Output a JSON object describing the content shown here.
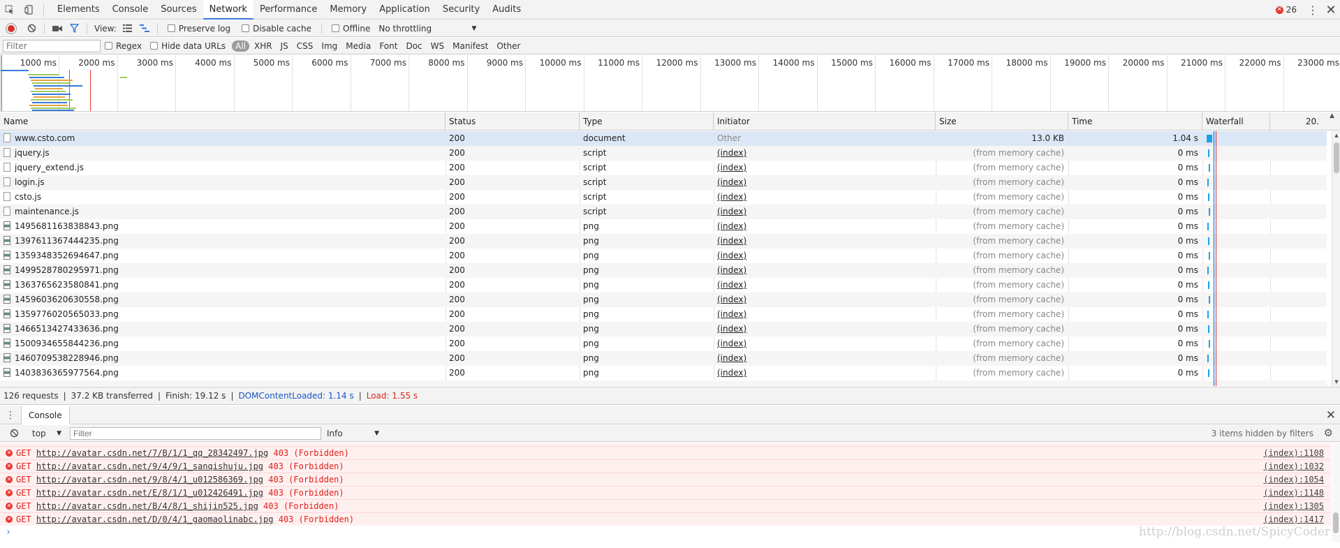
{
  "tabs": [
    "Elements",
    "Console",
    "Sources",
    "Network",
    "Performance",
    "Memory",
    "Application",
    "Security",
    "Audits"
  ],
  "active_tab": "Network",
  "error_count": "26",
  "toolbar": {
    "view_label": "View:",
    "preserve_log": "Preserve log",
    "disable_cache": "Disable cache",
    "offline": "Offline",
    "throttling": "No throttling"
  },
  "filterbar": {
    "placeholder": "Filter",
    "regex": "Regex",
    "hide_data_urls": "Hide data URLs",
    "types": [
      "All",
      "XHR",
      "JS",
      "CSS",
      "Img",
      "Media",
      "Font",
      "Doc",
      "WS",
      "Manifest",
      "Other"
    ]
  },
  "overview_ticks": [
    "1000 ms",
    "2000 ms",
    "3000 ms",
    "4000 ms",
    "5000 ms",
    "6000 ms",
    "7000 ms",
    "8000 ms",
    "9000 ms",
    "10000 ms",
    "11000 ms",
    "12000 ms",
    "13000 ms",
    "14000 ms",
    "15000 ms",
    "16000 ms",
    "17000 ms",
    "18000 ms",
    "19000 ms",
    "20000 ms",
    "21000 ms",
    "22000 ms",
    "23000 ms"
  ],
  "columns": {
    "name": "Name",
    "status": "Status",
    "type": "Type",
    "initiator": "Initiator",
    "size": "Size",
    "time": "Time",
    "waterfall": "Waterfall",
    "waterfall_scale": "20."
  },
  "rows": [
    {
      "name": "www.csto.com",
      "status": "200",
      "type": "document",
      "initiator": "Other",
      "size": "13.0 KB",
      "time": "1.04 s"
    },
    {
      "name": "jquery.js",
      "status": "200",
      "type": "script",
      "initiator": "(index)",
      "size": "(from memory cache)",
      "time": "0 ms"
    },
    {
      "name": "jquery_extend.js",
      "status": "200",
      "type": "script",
      "initiator": "(index)",
      "size": "(from memory cache)",
      "time": "0 ms"
    },
    {
      "name": "login.js",
      "status": "200",
      "type": "script",
      "initiator": "(index)",
      "size": "(from memory cache)",
      "time": "0 ms"
    },
    {
      "name": "csto.js",
      "status": "200",
      "type": "script",
      "initiator": "(index)",
      "size": "(from memory cache)",
      "time": "0 ms"
    },
    {
      "name": "maintenance.js",
      "status": "200",
      "type": "script",
      "initiator": "(index)",
      "size": "(from memory cache)",
      "time": "0 ms"
    },
    {
      "name": "1495681163838843.png",
      "status": "200",
      "type": "png",
      "initiator": "(index)",
      "size": "(from memory cache)",
      "time": "0 ms"
    },
    {
      "name": "1397611367444235.png",
      "status": "200",
      "type": "png",
      "initiator": "(index)",
      "size": "(from memory cache)",
      "time": "0 ms"
    },
    {
      "name": "1359348352694647.png",
      "status": "200",
      "type": "png",
      "initiator": "(index)",
      "size": "(from memory cache)",
      "time": "0 ms"
    },
    {
      "name": "1499528780295971.png",
      "status": "200",
      "type": "png",
      "initiator": "(index)",
      "size": "(from memory cache)",
      "time": "0 ms"
    },
    {
      "name": "1363765623580841.png",
      "status": "200",
      "type": "png",
      "initiator": "(index)",
      "size": "(from memory cache)",
      "time": "0 ms"
    },
    {
      "name": "1459603620630558.png",
      "status": "200",
      "type": "png",
      "initiator": "(index)",
      "size": "(from memory cache)",
      "time": "0 ms"
    },
    {
      "name": "1359776020565033.png",
      "status": "200",
      "type": "png",
      "initiator": "(index)",
      "size": "(from memory cache)",
      "time": "0 ms"
    },
    {
      "name": "1466513427433636.png",
      "status": "200",
      "type": "png",
      "initiator": "(index)",
      "size": "(from memory cache)",
      "time": "0 ms"
    },
    {
      "name": "1500934655844236.png",
      "status": "200",
      "type": "png",
      "initiator": "(index)",
      "size": "(from memory cache)",
      "time": "0 ms"
    },
    {
      "name": "1460709538228946.png",
      "status": "200",
      "type": "png",
      "initiator": "(index)",
      "size": "(from memory cache)",
      "time": "0 ms"
    },
    {
      "name": "1403836365977564.png",
      "status": "200",
      "type": "png",
      "initiator": "(index)",
      "size": "(from memory cache)",
      "time": "0 ms"
    }
  ],
  "summary": {
    "requests": "126 requests",
    "transferred": "37.2 KB transferred",
    "finish": "Finish: 19.12 s",
    "dom_content_loaded": "DOMContentLoaded: 1.14 s",
    "load": "Load: 1.55 s"
  },
  "drawer": {
    "tab": "Console",
    "context": "top",
    "filter_placeholder": "Filter",
    "level": "Info",
    "hidden": "3 items hidden by filters"
  },
  "console_messages": [
    {
      "method": "GET",
      "url": "http://avatar.csdn.net/7/B/1/1_qq_28342497.jpg",
      "status": "403 (Forbidden)",
      "source": "(index):1108"
    },
    {
      "method": "GET",
      "url": "http://avatar.csdn.net/9/4/9/1_sanqishuju.jpg",
      "status": "403 (Forbidden)",
      "source": "(index):1032"
    },
    {
      "method": "GET",
      "url": "http://avatar.csdn.net/9/8/4/1_u012586369.jpg",
      "status": "403 (Forbidden)",
      "source": "(index):1054"
    },
    {
      "method": "GET",
      "url": "http://avatar.csdn.net/E/8/1/1_u012426491.jpg",
      "status": "403 (Forbidden)",
      "source": "(index):1148"
    },
    {
      "method": "GET",
      "url": "http://avatar.csdn.net/B/4/8/1_shijin525.jpg",
      "status": "403 (Forbidden)",
      "source": "(index):1305"
    },
    {
      "method": "GET",
      "url": "http://avatar.csdn.net/D/0/4/1_gaomaolinabc.jpg",
      "status": "403 (Forbidden)",
      "source": "(index):1417"
    }
  ],
  "watermark": "http://blog.csdn.net/SpicyCoder",
  "colors": {
    "accent": "#3879d9",
    "error": "#e8352d",
    "selected_row": "#dbe7f6",
    "dom_line": "#1a56c8",
    "load_line": "#d8281e"
  }
}
